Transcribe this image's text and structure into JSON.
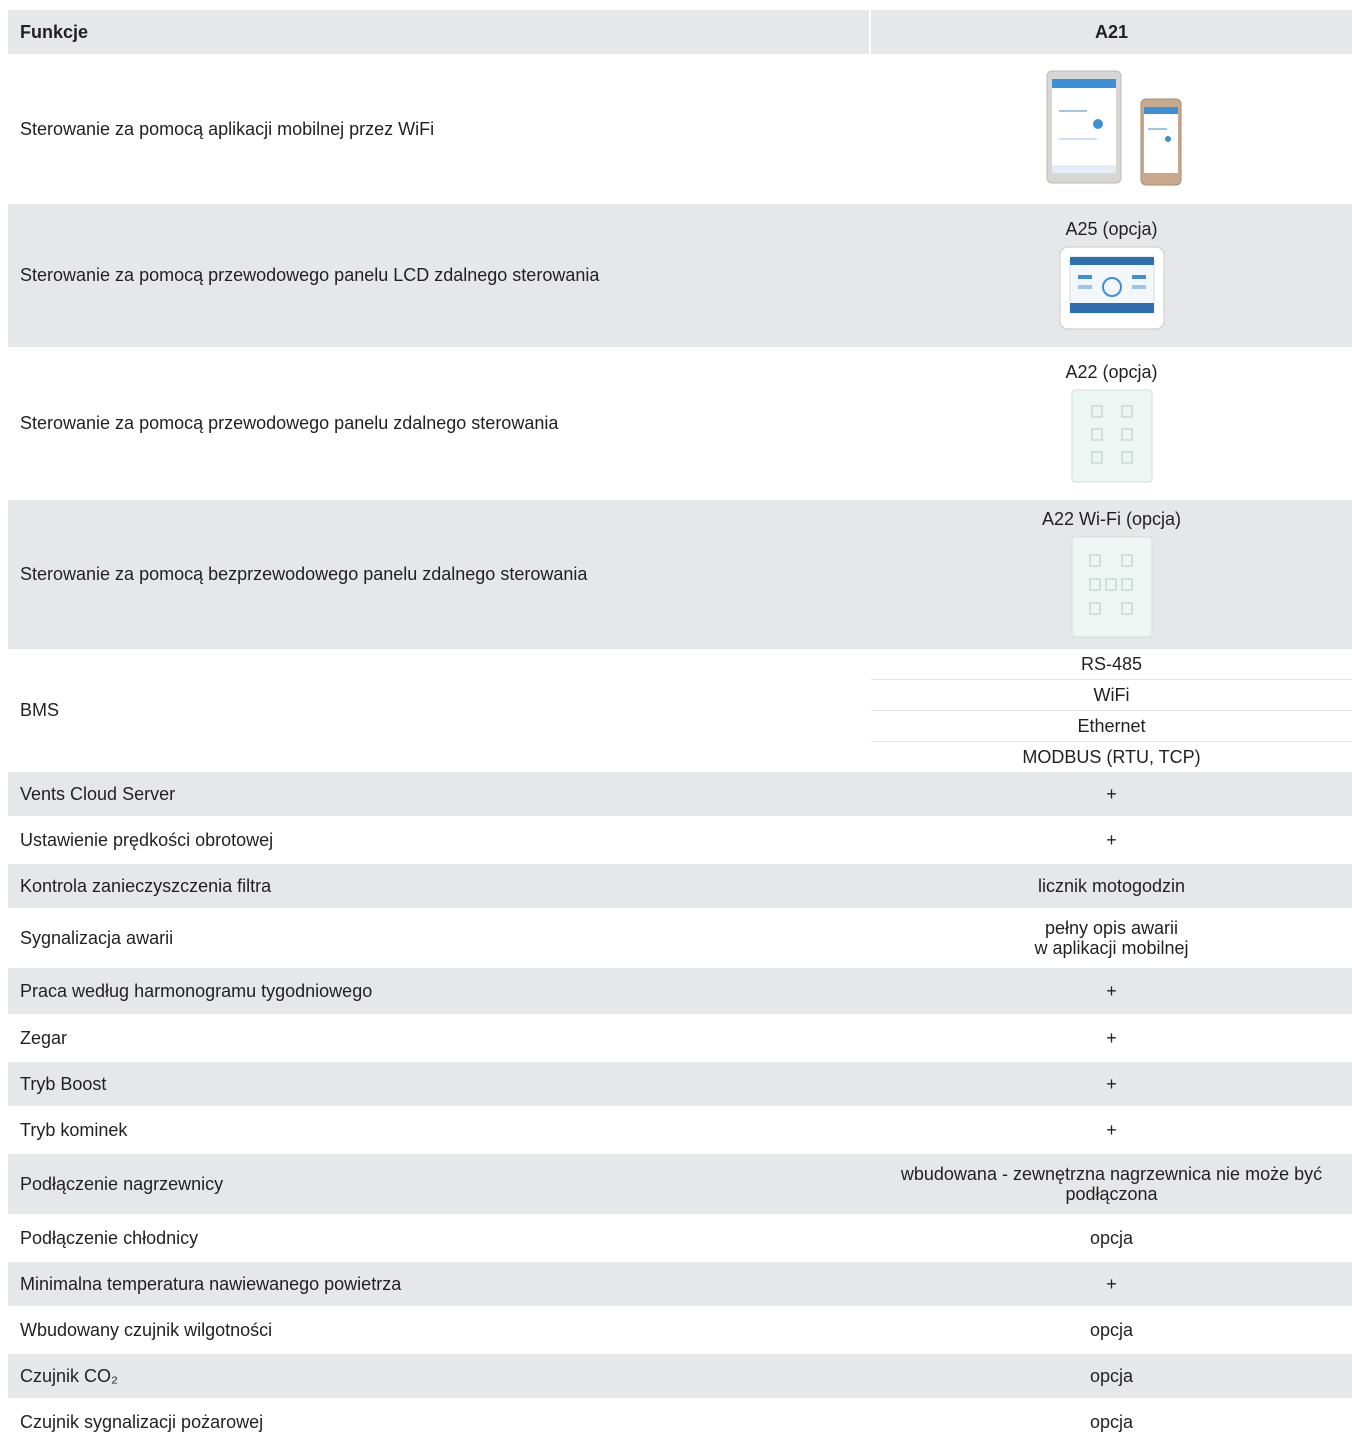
{
  "table": {
    "header": {
      "feature": "Funkcje",
      "model": "A21"
    },
    "rows": [
      {
        "feature": "Sterowanie za pomocą aplikacji mobilnej przez WiFi",
        "value": ""
      },
      {
        "feature": "Sterowanie za pomocą przewodowego panelu LCD zdalnego sterowania",
        "value": "A25 (opcja)"
      },
      {
        "feature": "Sterowanie za pomocą przewodowego panelu zdalnego sterowania",
        "value": "A22 (opcja)"
      },
      {
        "feature": "Sterowanie za pomocą bezprzewodowego panelu zdalnego sterowania",
        "value": "A22 Wi-Fi (opcja)"
      },
      {
        "feature": "BMS",
        "values": [
          "RS-485",
          "WiFi",
          "Ethernet",
          "MODBUS (RTU, TCP)"
        ]
      },
      {
        "feature": "Vents Cloud Server",
        "value": "+"
      },
      {
        "feature": "Ustawienie prędkości obrotowej",
        "value": "+"
      },
      {
        "feature": "Kontrola zanieczyszczenia filtra",
        "value": "licznik motogodzin"
      },
      {
        "feature": "Sygnalizacja awarii",
        "value_lines": [
          "pełny opis awarii",
          "w aplikacji mobilnej"
        ]
      },
      {
        "feature": "Praca według harmonogramu tygodniowego",
        "value": "+"
      },
      {
        "feature": "Zegar",
        "value": "+"
      },
      {
        "feature": "Tryb Boost",
        "value": "+"
      },
      {
        "feature": "Tryb kominek",
        "value": "+"
      },
      {
        "feature": "Podłączenie nagrzewnicy",
        "value_lines": [
          "wbudowana - zewnętrzna nagrzewnica nie może być",
          "podłączona"
        ]
      },
      {
        "feature": "Podłączenie chłodnicy",
        "value": "opcja"
      },
      {
        "feature": "Minimalna temperatura nawiewanego powietrza",
        "value": "+"
      },
      {
        "feature": "Wbudowany czujnik wilgotności",
        "value": "opcja"
      },
      {
        "feature": "Czujnik CO₂",
        "value": "opcja"
      },
      {
        "feature": "Czujnik sygnalizacji pożarowej",
        "value": "opcja"
      }
    ]
  },
  "colors": {
    "row_grey": "#e6e7e8",
    "row_white": "#ffffff",
    "text": "#231f20",
    "screen_blue": "#3d8fd6"
  }
}
